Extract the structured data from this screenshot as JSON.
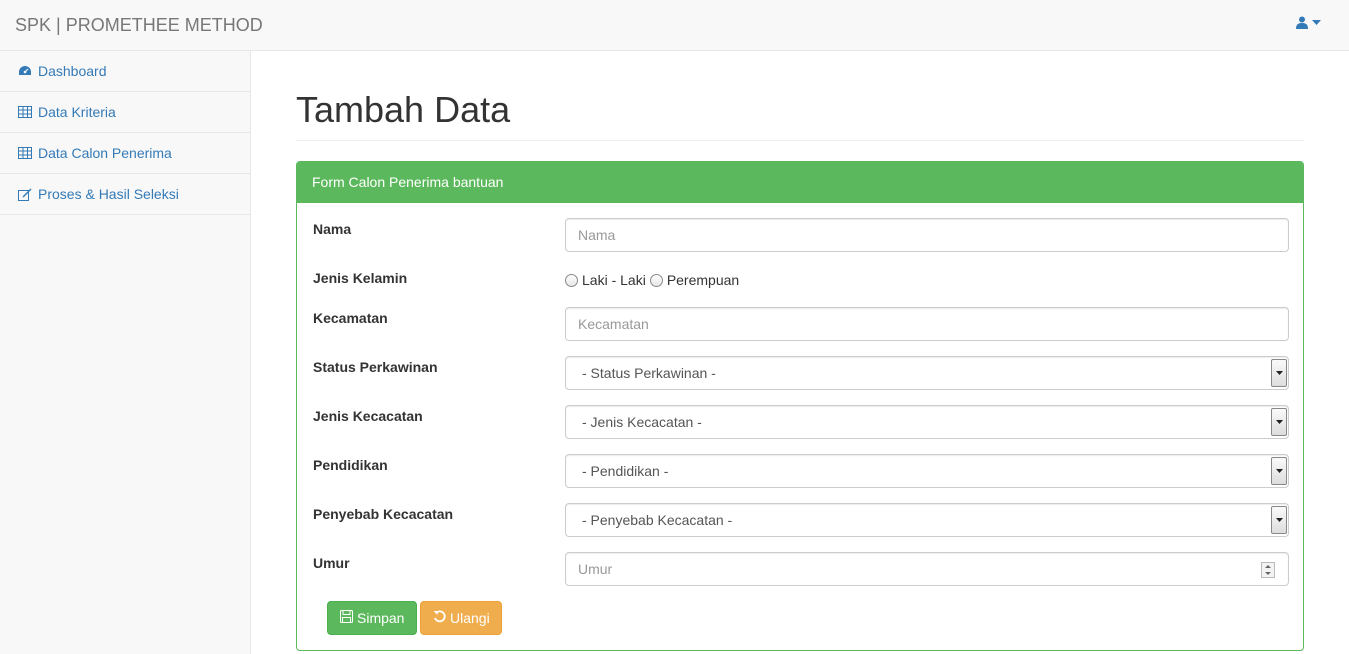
{
  "app": {
    "brand": "SPK | PROMETHEE METHOD"
  },
  "sidebar": {
    "items": [
      {
        "label": "Dashboard",
        "icon": "dashboard-icon"
      },
      {
        "label": "Data Kriteria",
        "icon": "table-icon"
      },
      {
        "label": "Data Calon Penerima",
        "icon": "table-icon"
      },
      {
        "label": "Proses & Hasil Seleksi",
        "icon": "edit-icon"
      }
    ]
  },
  "page": {
    "title": "Tambah Data"
  },
  "form": {
    "heading": "Form Calon Penerima bantuan",
    "nama": {
      "label": "Nama",
      "placeholder": "Nama"
    },
    "jenis_kelamin": {
      "label": "Jenis Kelamin",
      "options": [
        "Laki - Laki",
        "Perempuan"
      ]
    },
    "kecamatan": {
      "label": "Kecamatan",
      "placeholder": "Kecamatan"
    },
    "status_perkawinan": {
      "label": "Status Perkawinan",
      "selected": "- Status Perkawinan -"
    },
    "jenis_kecacatan": {
      "label": "Jenis Kecacatan",
      "selected": "- Jenis Kecacatan -"
    },
    "pendidikan": {
      "label": "Pendidikan",
      "selected": "- Pendidikan -"
    },
    "penyebab_kecacatan": {
      "label": "Penyebab Kecacatan",
      "selected": "- Penyebab Kecacatan -"
    },
    "umur": {
      "label": "Umur",
      "placeholder": "Umur"
    },
    "buttons": {
      "save": "Simpan",
      "reset": "Ulangi"
    }
  },
  "colors": {
    "primary_link": "#337ab7",
    "success": "#5cb85c",
    "warning": "#f0ad4e"
  }
}
